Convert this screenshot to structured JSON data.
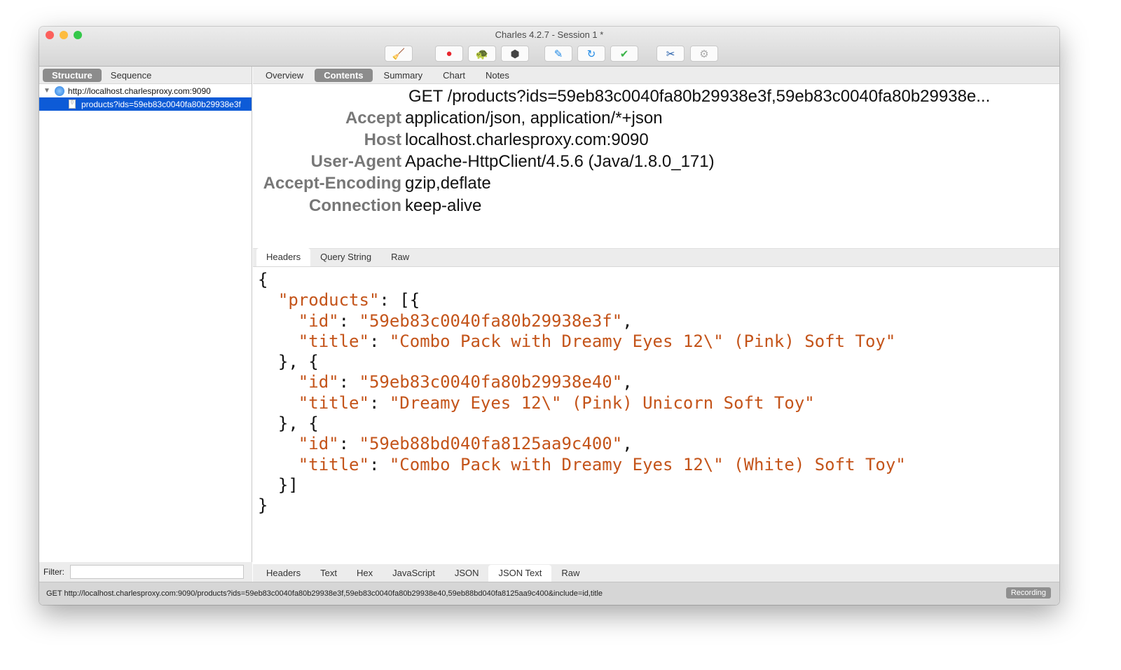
{
  "window": {
    "title": "Charles 4.2.7 - Session 1 *"
  },
  "toolbar": [
    {
      "icon": "broom-icon",
      "glyph": "🧹"
    },
    {
      "icon": "record-icon",
      "glyph": "●",
      "color": "#e8262e"
    },
    {
      "icon": "throttle-turtle-icon",
      "glyph": "🐢"
    },
    {
      "icon": "breakpoints-hexagon-icon",
      "glyph": "⬢",
      "color": "#444"
    },
    {
      "icon": "compose-pen-icon",
      "glyph": "✎",
      "color": "#1e88e5"
    },
    {
      "icon": "repeat-icon",
      "glyph": "↻",
      "color": "#1e88e5"
    },
    {
      "icon": "validate-check-icon",
      "glyph": "✔",
      "color": "#3cb44a"
    },
    {
      "icon": "tools-icon",
      "glyph": "✂",
      "color": "#1e5aa8"
    },
    {
      "icon": "settings-gear-icon",
      "glyph": "⚙",
      "color": "#aaa"
    }
  ],
  "left": {
    "tabs": [
      "Structure",
      "Sequence"
    ],
    "host": "http://localhost.charlesproxy.com:9090",
    "request": "products?ids=59eb83c0040fa80b29938e3f",
    "filter_label": "Filter:",
    "filter_value": ""
  },
  "right": {
    "tabs": [
      "Overview",
      "Contents",
      "Summary",
      "Chart",
      "Notes"
    ],
    "request_line": "GET /products?ids=59eb83c0040fa80b29938e3f,59eb83c0040fa80b29938e...",
    "headers": [
      {
        "k": "Accept",
        "v": "application/json, application/*+json"
      },
      {
        "k": "Host",
        "v": "localhost.charlesproxy.com:9090"
      },
      {
        "k": "User-Agent",
        "v": "Apache-HttpClient/4.5.6 (Java/1.8.0_171)"
      },
      {
        "k": "Accept-Encoding",
        "v": "gzip,deflate"
      },
      {
        "k": "Connection",
        "v": "keep-alive"
      }
    ],
    "request_tabs": [
      "Headers",
      "Query String",
      "Raw"
    ],
    "response_tabs": [
      "Headers",
      "Text",
      "Hex",
      "JavaScript",
      "JSON",
      "JSON Text",
      "Raw"
    ],
    "json_lines": [
      [
        [
          "{",
          0
        ]
      ],
      [
        [
          "  ",
          0
        ],
        [
          "\"products\"",
          1
        ],
        [
          ": [{",
          0
        ]
      ],
      [
        [
          "    ",
          0
        ],
        [
          "\"id\"",
          1
        ],
        [
          ": ",
          0
        ],
        [
          "\"59eb83c0040fa80b29938e3f\"",
          1
        ],
        [
          ",",
          0
        ]
      ],
      [
        [
          "    ",
          0
        ],
        [
          "\"title\"",
          1
        ],
        [
          ": ",
          0
        ],
        [
          "\"Combo Pack with Dreamy Eyes 12\\\" (Pink) Soft Toy\"",
          1
        ]
      ],
      [
        [
          "  }, {",
          0
        ]
      ],
      [
        [
          "    ",
          0
        ],
        [
          "\"id\"",
          1
        ],
        [
          ": ",
          0
        ],
        [
          "\"59eb83c0040fa80b29938e40\"",
          1
        ],
        [
          ",",
          0
        ]
      ],
      [
        [
          "    ",
          0
        ],
        [
          "\"title\"",
          1
        ],
        [
          ": ",
          0
        ],
        [
          "\"Dreamy Eyes 12\\\" (Pink) Unicorn Soft Toy\"",
          1
        ]
      ],
      [
        [
          "  }, {",
          0
        ]
      ],
      [
        [
          "    ",
          0
        ],
        [
          "\"id\"",
          1
        ],
        [
          ": ",
          0
        ],
        [
          "\"59eb88bd040fa8125aa9c400\"",
          1
        ],
        [
          ",",
          0
        ]
      ],
      [
        [
          "    ",
          0
        ],
        [
          "\"title\"",
          1
        ],
        [
          ": ",
          0
        ],
        [
          "\"Combo Pack with Dreamy Eyes 12\\\" (White) Soft Toy\"",
          1
        ]
      ],
      [
        [
          "  }]",
          0
        ]
      ],
      [
        [
          "}",
          0
        ]
      ]
    ]
  },
  "status": {
    "text": "GET http://localhost.charlesproxy.com:9090/products?ids=59eb83c0040fa80b29938e3f,59eb83c0040fa80b29938e40,59eb88bd040fa8125aa9c400&include=id,title",
    "recording": "Recording"
  }
}
